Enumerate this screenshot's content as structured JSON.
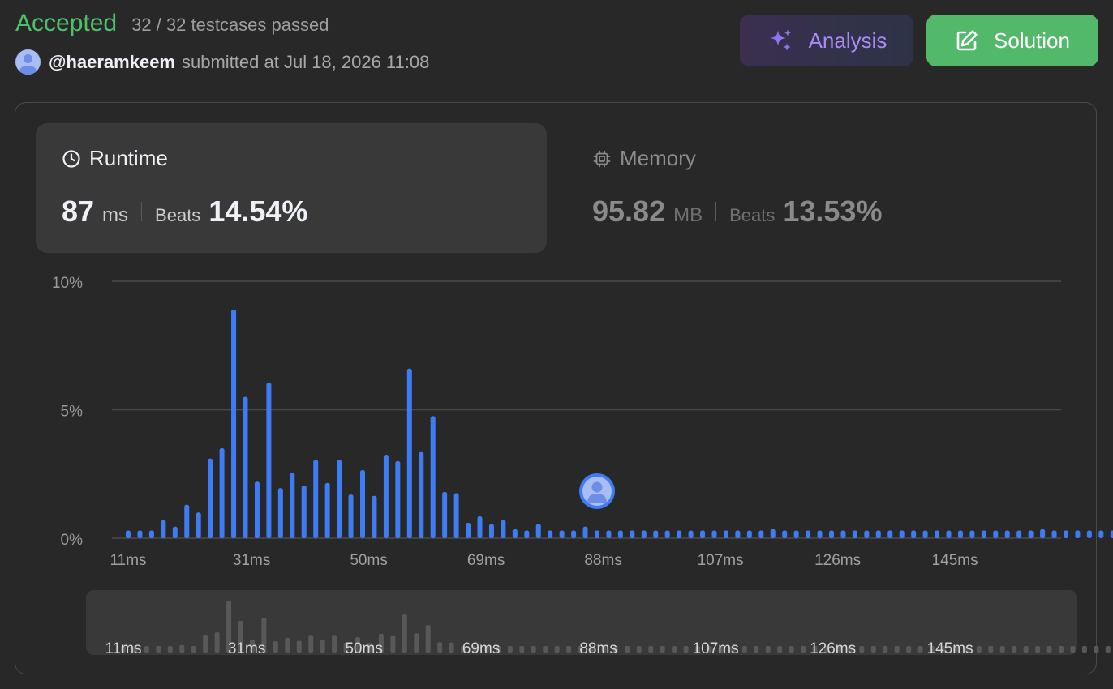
{
  "header": {
    "status": "Accepted",
    "testcases": "32 / 32 testcases passed",
    "username": "@haeramkeem",
    "submitted": "submitted at Jul 18, 2026 11:08"
  },
  "buttons": {
    "analysis": "Analysis",
    "solution": "Solution"
  },
  "runtime": {
    "title": "Runtime",
    "value": "87",
    "unit": "ms",
    "beats_label": "Beats",
    "beats": "14.54%"
  },
  "memory": {
    "title": "Memory",
    "value": "95.82",
    "unit": "MB",
    "beats_label": "Beats",
    "beats": "13.53%"
  },
  "colors": {
    "accepted": "#4ec06a",
    "bar": "#3d7cf5",
    "bar_muted": "#585858",
    "solution_button": "#52b96b",
    "analysis_text": "#a98bf2"
  },
  "chart_data": {
    "type": "bar",
    "xlabel": "",
    "ylabel": "",
    "y_ticks": [
      "0%",
      "5%",
      "10%"
    ],
    "ylim": [
      0,
      10
    ],
    "x_tick_labels": [
      "11ms",
      "31ms",
      "50ms",
      "69ms",
      "88ms",
      "107ms",
      "126ms",
      "145ms"
    ],
    "x_first": 11,
    "x_step": 1.9,
    "grid": true,
    "user_marker_runtime_ms": 87,
    "series": [
      {
        "values": [
          0.3,
          0.3,
          0.3,
          0.7,
          0.45,
          1.3,
          1.0,
          3.1,
          3.5,
          8.9,
          5.5,
          2.2,
          6.05,
          1.95,
          2.55,
          2.05,
          3.05,
          2.15,
          3.05,
          1.7,
          2.65,
          1.65,
          3.25,
          3.0,
          6.6,
          3.35,
          4.75,
          1.8,
          1.75,
          0.6,
          0.85,
          0.55,
          0.7,
          0.35,
          0.3,
          0.55,
          0.3,
          0.3,
          0.3,
          0.45,
          0.3,
          0.3,
          0.3,
          0.3,
          0.3,
          0.3,
          0.3,
          0.3,
          0.3,
          0.3,
          0.3,
          0.3,
          0.3,
          0.3,
          0.3,
          0.35,
          0.3,
          0.3,
          0.3,
          0.3,
          0.3,
          0.3,
          0.3,
          0.3,
          0.3,
          0.3,
          0.3,
          0.3,
          0.3,
          0.3,
          0.3,
          0.3,
          0.3,
          0.3,
          0.3,
          0.3,
          0.3,
          0.3,
          0.35,
          0.3,
          0.3,
          0.3,
          0.3,
          0.3,
          0.3,
          0.3,
          0.3,
          0.3,
          0.3,
          0.3
        ]
      }
    ]
  }
}
